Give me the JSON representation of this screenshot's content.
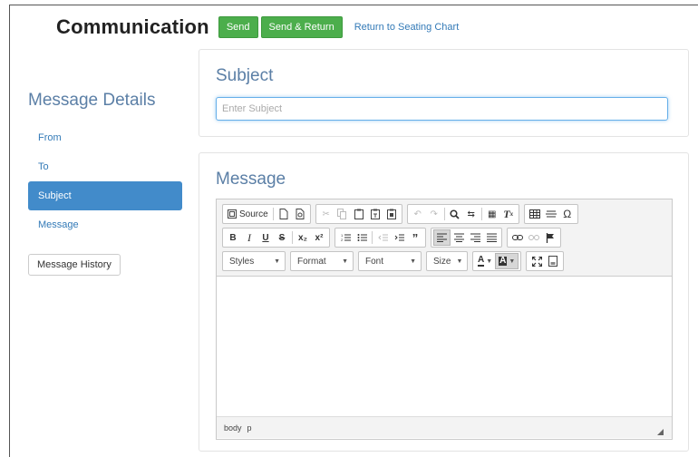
{
  "header": {
    "title": "Communication",
    "send_label": "Send",
    "send_return_label": "Send & Return",
    "return_link": "Return to Seating Chart"
  },
  "sidebar": {
    "title": "Message Details",
    "items": [
      {
        "label": "From"
      },
      {
        "label": "To"
      },
      {
        "label": "Subject"
      },
      {
        "label": "Message"
      }
    ],
    "active_index": 2,
    "history_label": "Message History"
  },
  "subject": {
    "heading": "Subject",
    "placeholder": "Enter Subject",
    "value": ""
  },
  "message": {
    "heading": "Message",
    "toolbar": {
      "source_label": "Source",
      "combos": [
        {
          "label": "Styles"
        },
        {
          "label": "Format"
        },
        {
          "label": "Font"
        },
        {
          "label": "Size"
        }
      ],
      "format_buttons": {
        "bold": "B",
        "italic": "I",
        "underline": "U",
        "strike": "S",
        "subscript": "x₂",
        "superscript": "x²"
      },
      "text_color": "A",
      "bg_color": "A"
    },
    "path": [
      "body",
      "p"
    ]
  },
  "colors": {
    "accent": "#428bca",
    "success": "#4cae4c",
    "heading": "#5b7fa6",
    "link": "#337ab7"
  }
}
